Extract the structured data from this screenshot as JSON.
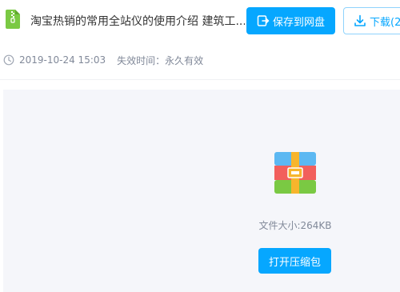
{
  "header": {
    "file_icon": "zip-file-icon",
    "title": "淘宝热销的常用全站仪的使用介绍 建筑工...",
    "save_button": {
      "label": "保存到网盘",
      "icon": "save-to-cloud-icon"
    },
    "download_button": {
      "label": "下载(2",
      "icon": "download-icon"
    }
  },
  "meta": {
    "clock_icon": "clock-icon",
    "date": "2019-10-24 15:03",
    "expiry": "失效时间：永久有效"
  },
  "preview": {
    "archive_icon": "archive-icon",
    "file_size": "文件大小:264KB",
    "open_button": "打开压缩包"
  },
  "colors": {
    "accent": "#06a7ff",
    "panel_bg": "#f5f6fa",
    "meta_text": "#818999"
  }
}
